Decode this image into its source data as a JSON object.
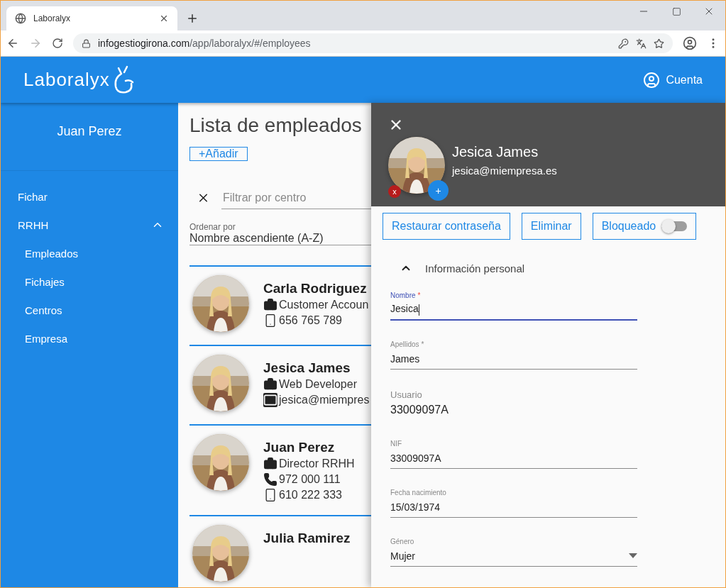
{
  "browser": {
    "tab_title": "Laboralyx",
    "url_host": "infogestiogirona.com",
    "url_path": "/app/laboralyx/#/employees"
  },
  "app_bar": {
    "logo": "Laboralyx",
    "account": "Cuenta"
  },
  "sidebar": {
    "user": "Juan Perez",
    "items": [
      {
        "label": "Fichar"
      },
      {
        "label": "RRHH",
        "expanded": true,
        "children": [
          {
            "label": "Empleados"
          },
          {
            "label": "Fichajes"
          },
          {
            "label": "Centros"
          },
          {
            "label": "Empresa"
          }
        ]
      }
    ]
  },
  "main": {
    "title": "Lista de empleados",
    "add_button": "+Añadir",
    "filter": {
      "placeholder": "Filtrar por centro"
    },
    "sort": {
      "label": "Ordenar por",
      "value": "Nombre ascendiente (A-Z)"
    },
    "employees": [
      {
        "name": "Carla Rodriguez",
        "lines": [
          {
            "kind": "job",
            "text": "Customer Accoun"
          },
          {
            "kind": "mobile",
            "text": "656 765 789"
          }
        ]
      },
      {
        "name": "Jesica James",
        "lines": [
          {
            "kind": "job",
            "text": "Web Developer"
          },
          {
            "kind": "email",
            "text": "jesica@miempres"
          }
        ]
      },
      {
        "name": "Juan Perez",
        "lines": [
          {
            "kind": "job",
            "text": "Director RRHH"
          },
          {
            "kind": "phone",
            "text": "972 000 111"
          },
          {
            "kind": "mobile",
            "text": "610 222 333"
          }
        ]
      },
      {
        "name": "Julia Ramirez"
      }
    ]
  },
  "drawer": {
    "name": "Jesica James",
    "email": "jesica@miempresa.es",
    "remove_badge": "x",
    "add_badge": "+",
    "buttons": [
      {
        "kind": "button",
        "label": "Restaurar contraseña"
      },
      {
        "kind": "button",
        "label": "Eliminar"
      },
      {
        "kind": "toggle",
        "label": "Bloqueado",
        "on": false
      }
    ],
    "section": {
      "title": "Información personal",
      "expanded": true
    },
    "fields": [
      {
        "kind": "text",
        "label": "Nombre",
        "required_mark": "*",
        "value": "Jesica",
        "focused": true
      },
      {
        "kind": "text",
        "label": "Apellidos",
        "required_mark": "*",
        "value": "James",
        "focused": false
      },
      {
        "kind": "readonly",
        "label": "Usuario",
        "value": "33009097A",
        "focused": false
      },
      {
        "kind": "text",
        "label": "NIF",
        "value": "33009097A",
        "focused": false
      },
      {
        "kind": "text",
        "label": "Fecha nacimiento",
        "value": "15/03/1974",
        "focused": false
      },
      {
        "kind": "select",
        "label": "Género",
        "value": "Mujer",
        "focused": false
      }
    ]
  }
}
